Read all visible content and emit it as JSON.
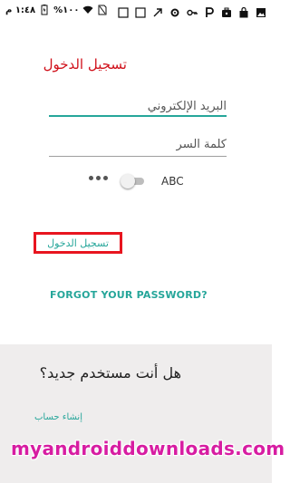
{
  "status_bar": {
    "time": "١:٤٨ م",
    "battery_percent": "%١٠٠",
    "icons_left": [
      "clock-text",
      "battery-icon",
      "wifi-icon",
      "sim-icon"
    ],
    "icons_right": [
      "square-icon",
      "square-icon",
      "arrow-icon",
      "gear-icon",
      "key-icon",
      "p-icon",
      "briefcase-icon",
      "shopping-bag-icon",
      "gallery-icon"
    ]
  },
  "login": {
    "title": "تسجيل الدخول",
    "email_placeholder": "البريد الإلكتروني",
    "password_placeholder": "كلمة السر",
    "toggle_label": "ABC",
    "submit_label": "تسجيل الدخول",
    "forgot_label": "FORGOT YOUR PASSWORD?"
  },
  "signup": {
    "question": "هل أنت مستخدم جديد؟",
    "create_label": "إنشاء حساب"
  },
  "watermark": "myandroiddownloads.com",
  "colors": {
    "title": "#d0101a",
    "accent": "#26a69a",
    "highlight_box": "#e8151f",
    "watermark": "#d71da2",
    "bottom_bg": "#efeded"
  }
}
